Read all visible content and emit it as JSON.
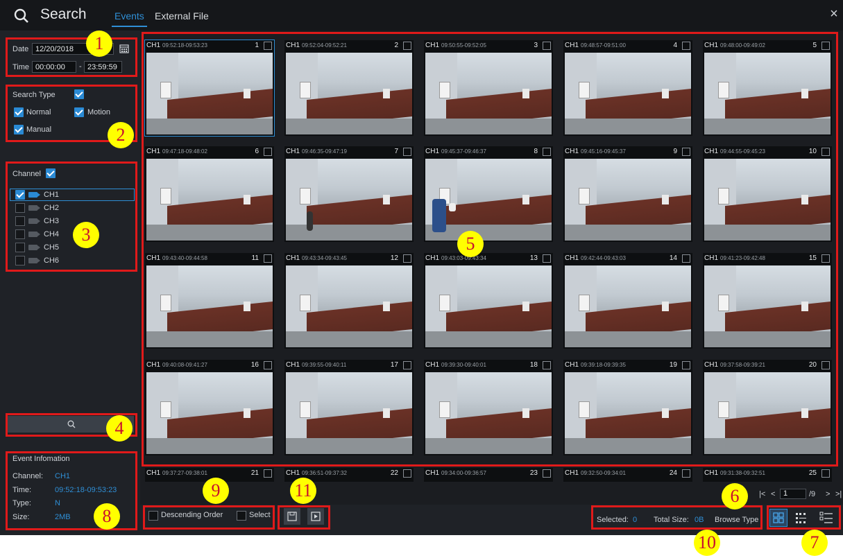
{
  "header": {
    "title": "Search",
    "tabs": [
      "Events",
      "External File"
    ],
    "close": "×"
  },
  "filters": {
    "date_label": "Date",
    "date_value": "12/20/2018",
    "time_label": "Time",
    "time_from": "00:00:00",
    "time_sep": "-",
    "time_to": "23:59:59",
    "search_type_label": "Search Type",
    "types": [
      "Normal",
      "Motion",
      "Manual"
    ]
  },
  "channels": {
    "label": "Channel",
    "items": [
      "CH1",
      "CH2",
      "CH3",
      "CH4",
      "CH5",
      "CH6"
    ]
  },
  "event_info": {
    "title": "Event Infomation",
    "channel_label": "Channel:",
    "channel_value": "CH1",
    "time_label": "Time:",
    "time_value": "09:52:18-09:53:23",
    "type_label": "Type:",
    "type_value": "N",
    "size_label": "Size:",
    "size_value": "2MB"
  },
  "events": [
    {
      "ch": "CH1",
      "time": "09:52:18-09:53:23",
      "num": "1"
    },
    {
      "ch": "CH1",
      "time": "09:52:04-09:52:21",
      "num": "2"
    },
    {
      "ch": "CH1",
      "time": "09:50:55-09:52:05",
      "num": "3"
    },
    {
      "ch": "CH1",
      "time": "09:48:57-09:51:00",
      "num": "4"
    },
    {
      "ch": "CH1",
      "time": "09:48:00-09:49:02",
      "num": "5"
    },
    {
      "ch": "CH1",
      "time": "09:47:18-09:48:02",
      "num": "6"
    },
    {
      "ch": "CH1",
      "time": "09:46:35-09:47:19",
      "num": "7"
    },
    {
      "ch": "CH1",
      "time": "09:45:37-09:46:37",
      "num": "8"
    },
    {
      "ch": "CH1",
      "time": "09:45:16-09:45:37",
      "num": "9"
    },
    {
      "ch": "CH1",
      "time": "09:44:55-09:45:23",
      "num": "10"
    },
    {
      "ch": "CH1",
      "time": "09:43:40-09:44:58",
      "num": "11"
    },
    {
      "ch": "CH1",
      "time": "09:43:34-09:43:45",
      "num": "12"
    },
    {
      "ch": "CH1",
      "time": "09:43:03-09:43:34",
      "num": "13"
    },
    {
      "ch": "CH1",
      "time": "09:42:44-09:43:03",
      "num": "14"
    },
    {
      "ch": "CH1",
      "time": "09:41:23-09:42:48",
      "num": "15"
    },
    {
      "ch": "CH1",
      "time": "09:40:08-09:41:27",
      "num": "16"
    },
    {
      "ch": "CH1",
      "time": "09:39:55-09:40:11",
      "num": "17"
    },
    {
      "ch": "CH1",
      "time": "09:39:30-09:40:01",
      "num": "18"
    },
    {
      "ch": "CH1",
      "time": "09:39:18-09:39:35",
      "num": "19"
    },
    {
      "ch": "CH1",
      "time": "09:37:58-09:39:21",
      "num": "20"
    },
    {
      "ch": "CH1",
      "time": "09:37:27-09:38:01",
      "num": "21"
    },
    {
      "ch": "CH1",
      "time": "09:36:51-09:37:32",
      "num": "22"
    },
    {
      "ch": "CH1",
      "time": "09:34:00-09:36:57",
      "num": "23"
    },
    {
      "ch": "CH1",
      "time": "09:32:50-09:34:01",
      "num": "24"
    },
    {
      "ch": "CH1",
      "time": "09:31:38-09:32:51",
      "num": "25"
    }
  ],
  "pager": {
    "page": "1",
    "total": "/9"
  },
  "bottom": {
    "descending": "Descending Order",
    "select": "Select",
    "selected_label": "Selected:",
    "selected_value": "0",
    "total_size_label": "Total Size:",
    "total_size_value": "0B",
    "browse_type": "Browse Type"
  },
  "callouts": [
    "1",
    "2",
    "3",
    "4",
    "5",
    "6",
    "7",
    "8",
    "9",
    "10",
    "11"
  ]
}
